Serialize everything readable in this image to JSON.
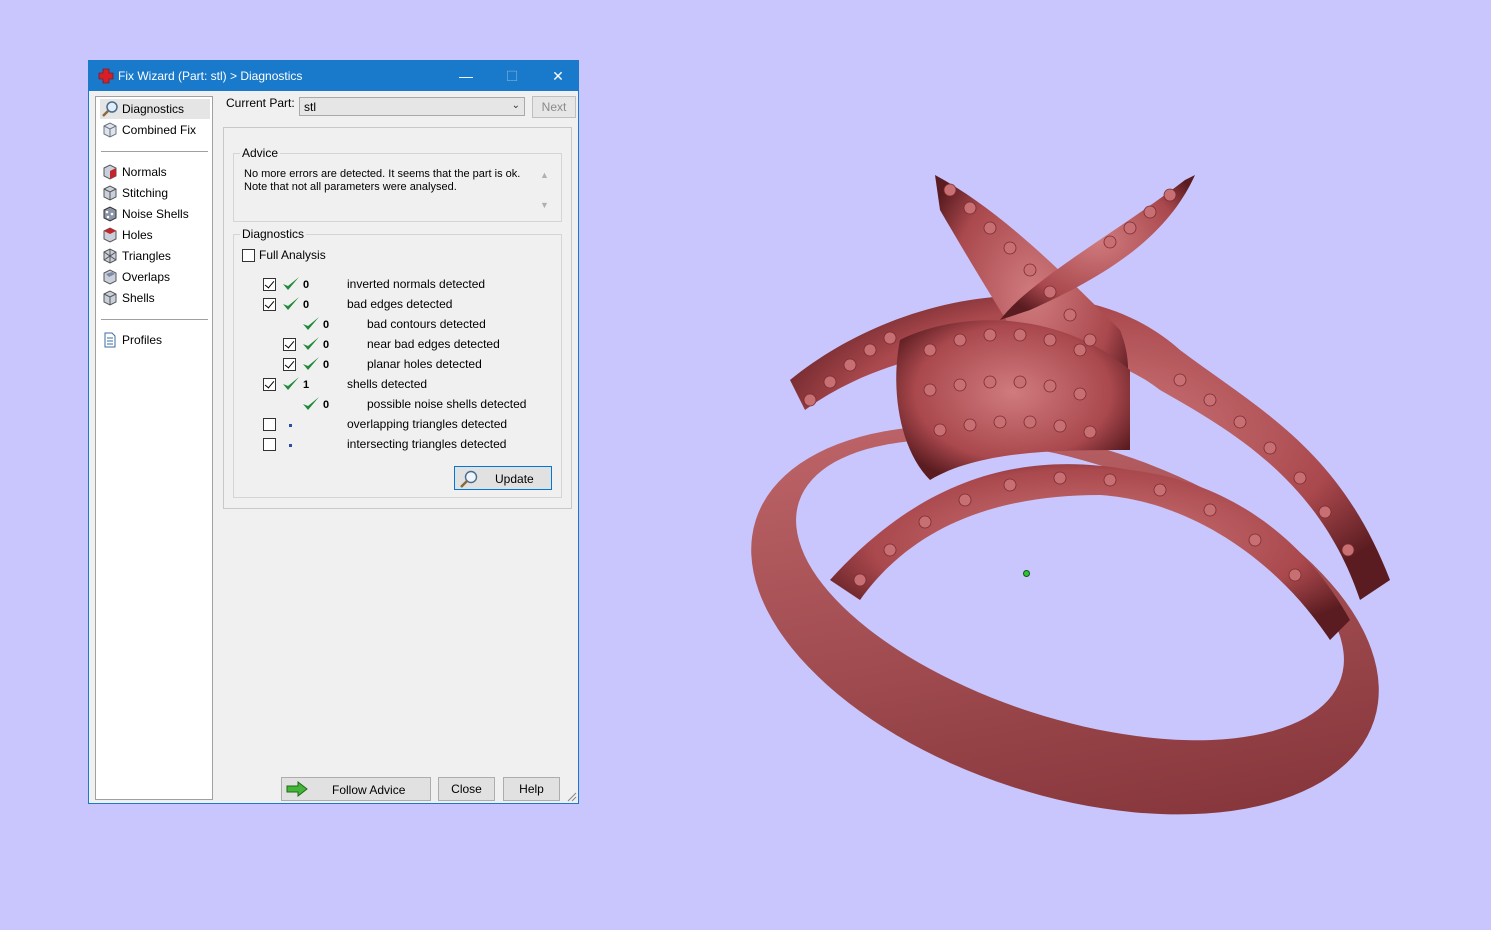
{
  "window": {
    "title": "Fix Wizard (Part: stl) > Diagnostics",
    "controls": {
      "minimize": "—",
      "maximize": "☐",
      "close": "✕"
    }
  },
  "sidebar": {
    "items": [
      {
        "label": "Diagnostics",
        "icon": "magnifier-icon",
        "selected": true
      },
      {
        "label": "Combined Fix",
        "icon": "cube-icon"
      },
      {
        "label": "Normals",
        "icon": "normals-cube-icon"
      },
      {
        "label": "Stitching",
        "icon": "stitching-cube-icon"
      },
      {
        "label": "Noise Shells",
        "icon": "noise-shells-icon"
      },
      {
        "label": "Holes",
        "icon": "holes-cube-icon"
      },
      {
        "label": "Triangles",
        "icon": "triangles-icon"
      },
      {
        "label": "Overlaps",
        "icon": "overlaps-cube-icon"
      },
      {
        "label": "Shells",
        "icon": "shells-cube-icon"
      },
      {
        "label": "Profiles",
        "icon": "document-icon"
      }
    ]
  },
  "current_part": {
    "label": "Current Part:",
    "value": "stl",
    "next_label": "Next"
  },
  "advice": {
    "title": "Advice",
    "text_line1": "No more errors are detected. It seems that the part is ok.",
    "text_line2": "Note that not all parameters were analysed."
  },
  "diagnostics": {
    "title": "Diagnostics",
    "full_analysis_label": "Full Analysis",
    "full_analysis_checked": false,
    "rows": [
      {
        "label": "inverted normals detected",
        "count": "0",
        "checked": true,
        "status": "ok",
        "indent": 0
      },
      {
        "label": "bad edges detected",
        "count": "0",
        "checked": true,
        "status": "ok",
        "indent": 0
      },
      {
        "label": "bad contours detected",
        "count": "0",
        "checked": null,
        "status": "ok",
        "indent": 1
      },
      {
        "label": "near bad edges detected",
        "count": "0",
        "checked": true,
        "status": "ok",
        "indent": 1
      },
      {
        "label": "planar holes detected",
        "count": "0",
        "checked": true,
        "status": "ok",
        "indent": 1
      },
      {
        "label": "shells detected",
        "count": "1",
        "checked": true,
        "status": "ok",
        "indent": 0
      },
      {
        "label": "possible noise shells detected",
        "count": "0",
        "checked": null,
        "status": "ok",
        "indent": 1
      },
      {
        "label": "overlapping triangles detected",
        "count": "",
        "checked": false,
        "status": "pending",
        "indent": 0
      },
      {
        "label": "intersecting triangles detected",
        "count": "",
        "checked": false,
        "status": "pending",
        "indent": 0
      }
    ],
    "update_label": "Update"
  },
  "footer": {
    "follow_advice_label": "Follow Advice",
    "close_label": "Close",
    "help_label": "Help"
  },
  "colors": {
    "background": "#c8c6fc",
    "titlebar": "#1979ca",
    "ring": "#b85a5e",
    "check_ok": "#1f8a3a"
  }
}
